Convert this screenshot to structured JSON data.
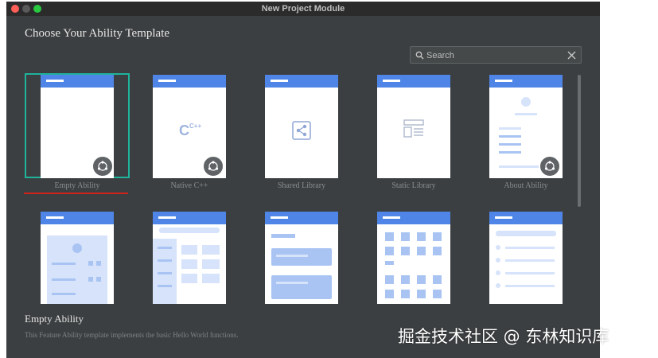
{
  "window": {
    "title": "New Project Module"
  },
  "heading": "Choose Your Ability Template",
  "search": {
    "placeholder": "Search"
  },
  "templates": [
    {
      "label": "Empty Ability",
      "selected": true
    },
    {
      "label": "Native C++",
      "icon_text": "C++"
    },
    {
      "label": "Shared Library"
    },
    {
      "label": "Static Library"
    },
    {
      "label": "About Ability"
    }
  ],
  "description": {
    "title": "Empty Ability",
    "text": "This Feature Ability template implements the basic Hello World functions."
  },
  "watermark": "掘金技术社区 @ 东林知识库",
  "colors": {
    "accent": "#4e85e6",
    "selection": "#1fb39c",
    "underline": "#d0231b",
    "background": "#3c3f41"
  }
}
